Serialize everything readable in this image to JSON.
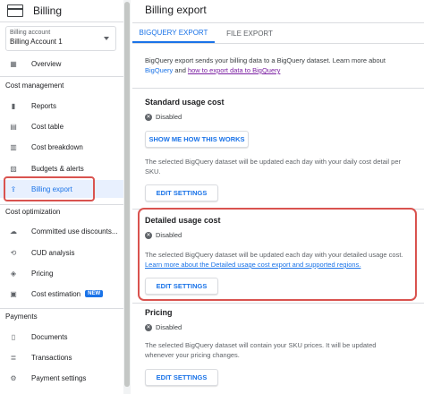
{
  "sidebar": {
    "title": "Billing",
    "account_label": "Billing account",
    "account_value": "Billing Account 1",
    "overview": "Overview",
    "cost_management_title": "Cost management",
    "cost_management": [
      "Reports",
      "Cost table",
      "Cost breakdown",
      "Budgets & alerts",
      "Billing export"
    ],
    "cost_optimization_title": "Cost optimization",
    "cost_optimization": [
      "Committed use discounts...",
      "CUD analysis",
      "Pricing",
      "Cost estimation"
    ],
    "new_badge": "NEW",
    "payments_title": "Payments",
    "payments": [
      "Documents",
      "Transactions",
      "Payment settings"
    ]
  },
  "main": {
    "title": "Billing export",
    "tabs": [
      "BIGQUERY EXPORT",
      "FILE EXPORT"
    ],
    "intro_text": "BigQuery export sends your billing data to a BigQuery dataset. Learn more about",
    "intro_link1": "BigQuery",
    "intro_and": "and",
    "intro_link2": "how to export data to BigQuery",
    "standard": {
      "heading": "Standard usage cost",
      "status": "Disabled",
      "button1": "SHOW ME HOW THIS WORKS",
      "desc": "The selected BigQuery dataset will be updated each day with your daily cost detail per SKU.",
      "button2": "EDIT SETTINGS"
    },
    "detailed": {
      "heading": "Detailed usage cost",
      "status": "Disabled",
      "desc": "The selected BigQuery dataset will be updated each day with your detailed usage cost.",
      "link": "Learn more about the Detailed usage cost export and supported regions.",
      "button": "EDIT SETTINGS"
    },
    "pricing": {
      "heading": "Pricing",
      "status": "Disabled",
      "desc": "The selected BigQuery dataset will contain your SKU prices. It will be updated whenever your pricing changes.",
      "button": "EDIT SETTINGS"
    }
  },
  "colors": {
    "accent": "#1a73e8",
    "highlight": "#d9534f",
    "active_bg": "#e8f0fe"
  }
}
